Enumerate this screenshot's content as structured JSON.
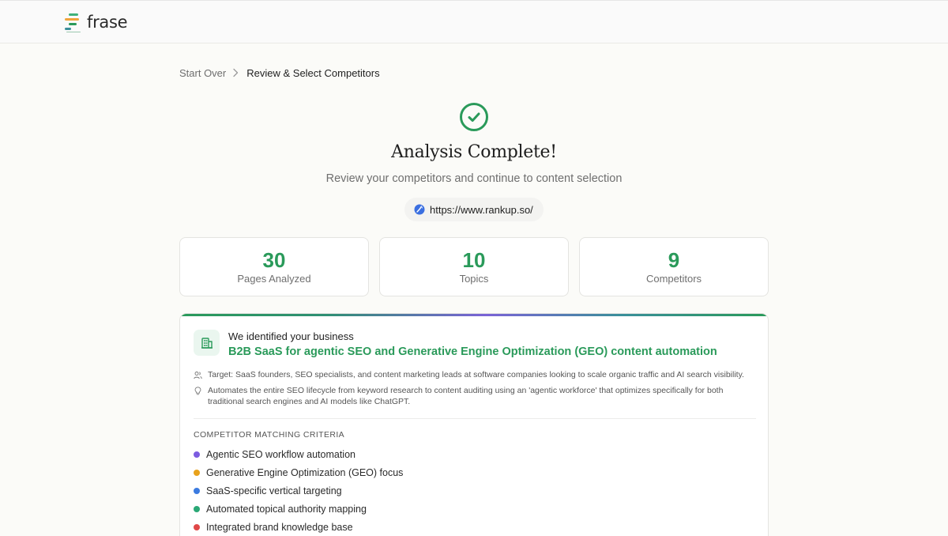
{
  "header": {
    "logo_text": "frase"
  },
  "breadcrumb": {
    "start_label": "Start Over",
    "current_label": "Review & Select Competitors"
  },
  "hero": {
    "title": "Analysis Complete!",
    "subtitle": "Review your competitors and continue to content selection",
    "url": "https://www.rankup.so/",
    "icon": "check-circle-icon"
  },
  "stats": [
    {
      "value": "30",
      "label": "Pages Analyzed"
    },
    {
      "value": "10",
      "label": "Topics"
    },
    {
      "value": "9",
      "label": "Competitors"
    }
  ],
  "business": {
    "heading": "We identified your business",
    "title": "B2B SaaS for agentic SEO and Generative Engine Optimization (GEO) content automation",
    "target": "Target: SaaS founders, SEO specialists, and content marketing leads at software companies looking to scale organic traffic and AI search visibility.",
    "description": "Automates the entire SEO lifecycle from keyword research to content auditing using an 'agentic workforce' that optimizes specifically for both traditional search engines and AI models like ChatGPT."
  },
  "criteria": {
    "heading": "COMPETITOR MATCHING CRITERIA",
    "items": [
      {
        "label": "Agentic SEO workflow automation",
        "color": "#7c5ce0"
      },
      {
        "label": "Generative Engine Optimization (GEO) focus",
        "color": "#e8a21c"
      },
      {
        "label": "SaaS-specific vertical targeting",
        "color": "#3b7be0"
      },
      {
        "label": "Automated topical authority mapping",
        "color": "#2aa876"
      },
      {
        "label": "Integrated brand knowledge base",
        "color": "#e04848"
      }
    ]
  },
  "colors": {
    "accent_green": "#2a9a5a",
    "background": "#fbfbf8"
  }
}
